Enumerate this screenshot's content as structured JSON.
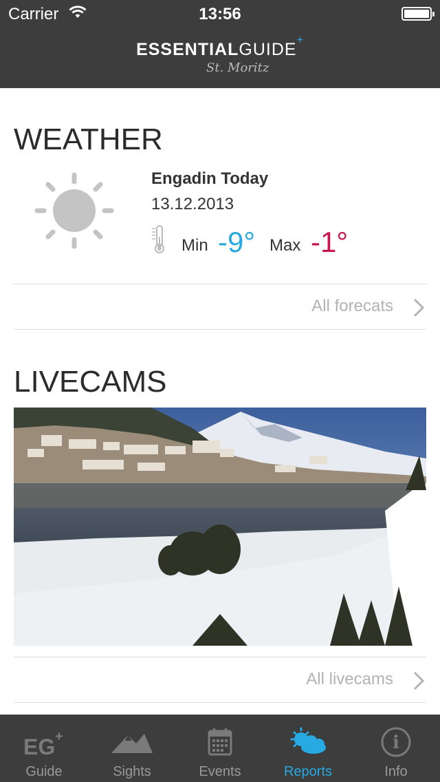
{
  "status_bar": {
    "carrier": "Carrier",
    "time": "13:56"
  },
  "header": {
    "logo_bold": "ESSENTIAL",
    "logo_light": "GUIDE",
    "logo_plus": "+",
    "logo_sub": "St. Moritz"
  },
  "weather": {
    "title": "WEATHER",
    "location": "Engadin Today",
    "date": "13.12.2013",
    "min_label": "Min",
    "min_value": "-9°",
    "max_label": "Max",
    "max_value": "-1°",
    "link": "All forecats"
  },
  "livecams": {
    "title": "LIVECAMS",
    "link": "All livecams"
  },
  "tabs": [
    {
      "label": "Guide",
      "icon": "eg-logo-icon",
      "active": false
    },
    {
      "label": "Sights",
      "icon": "mountain-icon",
      "active": false
    },
    {
      "label": "Events",
      "icon": "calendar-icon",
      "active": false
    },
    {
      "label": "Reports",
      "icon": "weather-cloud-sun-icon",
      "active": true
    },
    {
      "label": "Info",
      "icon": "info-icon",
      "active": false
    }
  ],
  "colors": {
    "accent": "#27a9e1",
    "max_temp": "#c8174c",
    "bar": "#3d3d3d"
  }
}
